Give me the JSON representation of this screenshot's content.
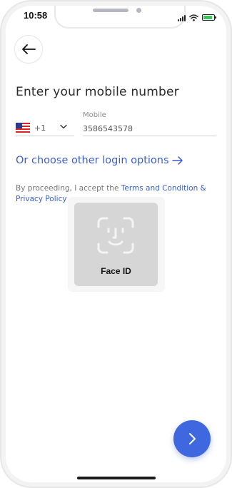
{
  "status_bar": {
    "time": "10:58"
  },
  "header": {
    "back_icon": "arrow-left-icon"
  },
  "form": {
    "title": "Enter your mobile number",
    "country": {
      "flag_icon": "us-flag-icon",
      "code": "+1"
    },
    "mobile": {
      "label": "Mobile",
      "value": "3586543578"
    }
  },
  "other_login": {
    "label": "Or choose other login options",
    "icon": "arrow-right-icon"
  },
  "terms": {
    "prefix": "By proceeding, I accept the ",
    "link": "Terms and Condition & Privacy Policy"
  },
  "face_id": {
    "label": "Face ID",
    "icon": "face-id-icon"
  },
  "next_button": {
    "icon": "chevron-right-icon"
  },
  "colors": {
    "accent": "#3f67e0",
    "link": "#3a5fcc",
    "title_text": "#2b2b2b"
  }
}
